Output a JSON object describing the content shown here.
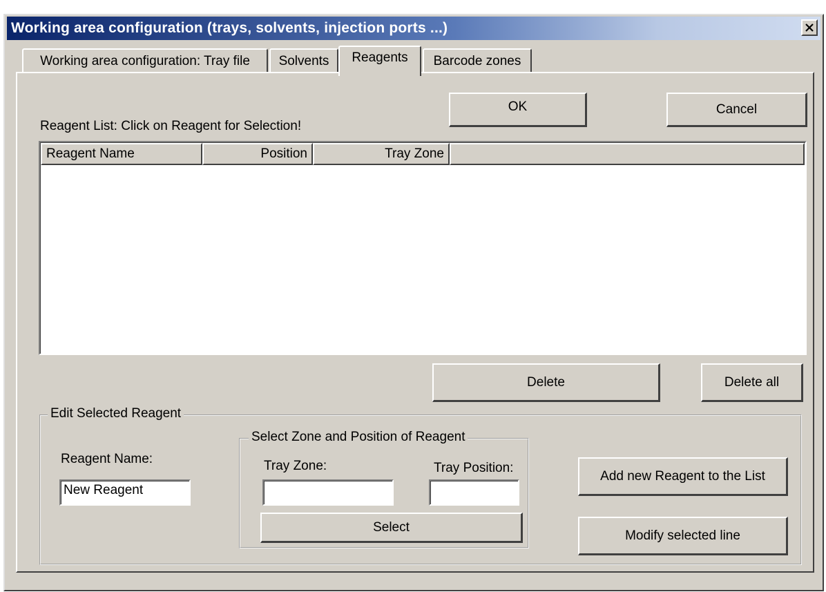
{
  "window": {
    "title": "Working area configuration (trays, solvents, injection ports ...)"
  },
  "tabs": [
    {
      "label": "Working area configuration: Tray file",
      "active": false
    },
    {
      "label": "Solvents",
      "active": false
    },
    {
      "label": "Reagents",
      "active": true
    },
    {
      "label": "Barcode zones",
      "active": false
    }
  ],
  "buttons": {
    "ok": "OK",
    "cancel": "Cancel",
    "delete": "Delete",
    "delete_all": "Delete all",
    "select": "Select",
    "add_new": "Add new Reagent to the List",
    "modify": "Modify selected line"
  },
  "reagent_list": {
    "caption": "Reagent List:  Click on Reagent for Selection!",
    "columns": [
      "Reagent Name",
      "Position",
      "Tray Zone"
    ],
    "rows": []
  },
  "edit_group": {
    "title": "Edit Selected Reagent",
    "name_label": "Reagent Name:",
    "name_value": "New Reagent",
    "zone_group": {
      "title": "Select Zone and Position of Reagent",
      "tray_zone_label": "Tray Zone:",
      "tray_zone_value": "",
      "tray_position_label": "Tray Position:",
      "tray_position_value": ""
    }
  },
  "icons": {
    "close": "close-icon"
  }
}
